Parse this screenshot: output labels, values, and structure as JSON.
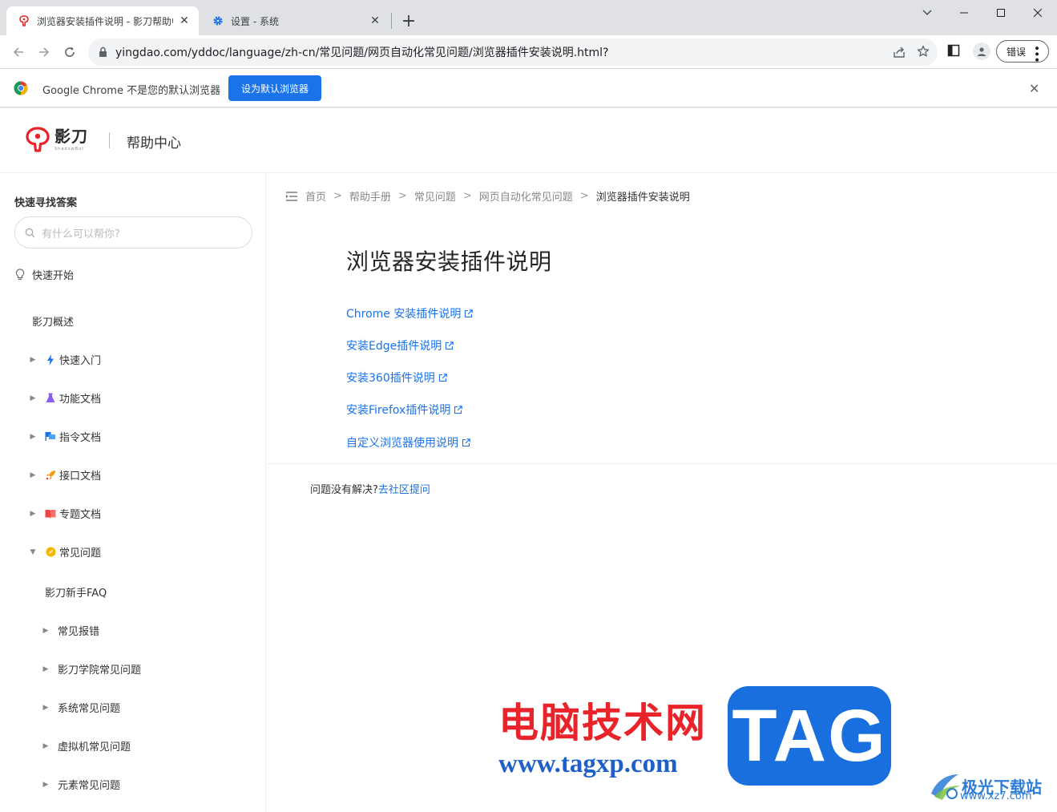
{
  "browser": {
    "tabs": [
      {
        "title": "浏览器安装插件说明 - 影刀帮助中心",
        "active": true
      },
      {
        "title": "设置 - 系统",
        "active": false
      }
    ],
    "url": "yingdao.com/yddoc/language/zh-cn/常见问题/网页自动化常见问题/浏览器插件安装说明.html?",
    "error_label": "错误",
    "infobar": {
      "message": "Google Chrome 不是您的默认浏览器",
      "button": "设为默认浏览器"
    }
  },
  "header": {
    "brand": "影刀",
    "brand_en": "ShadowBot",
    "title": "帮助中心"
  },
  "sidebar": {
    "title": "快速寻找答案",
    "search_placeholder": "有什么可以帮你?",
    "quick_start": "快速开始",
    "items": [
      {
        "label": "影刀概述"
      },
      {
        "label": "快速入门"
      },
      {
        "label": "功能文档"
      },
      {
        "label": "指令文档"
      },
      {
        "label": "接口文档"
      },
      {
        "label": "专题文档"
      },
      {
        "label": "常见问题"
      },
      {
        "label": "影刀新手FAQ"
      },
      {
        "label": "常见报错"
      },
      {
        "label": "影刀学院常见问题"
      },
      {
        "label": "系统常见问题"
      },
      {
        "label": "虚拟机常见问题"
      },
      {
        "label": "元素常见问题"
      }
    ]
  },
  "breadcrumb": [
    "首页",
    "帮助手册",
    "常见问题",
    "网页自动化常见问题",
    "浏览器插件安装说明"
  ],
  "main": {
    "title": "浏览器安装插件说明",
    "links": [
      "Chrome 安装插件说明",
      "安装Edge插件说明",
      "安装360插件说明",
      "安装Firefox插件说明",
      "自定义浏览器使用说明"
    ],
    "footer_text": "问题没有解决?",
    "footer_link": "去社区提问"
  },
  "watermark": {
    "line1": "电脑技术网",
    "line2": "www.tagxp.com",
    "tag": "TAG",
    "site_cn": "极光下载站",
    "site_url": "www.xz7.com"
  },
  "colors": {
    "link": "#1a73e8",
    "chrome_button": "#1a73e8",
    "brand_red": "#e8232a"
  }
}
